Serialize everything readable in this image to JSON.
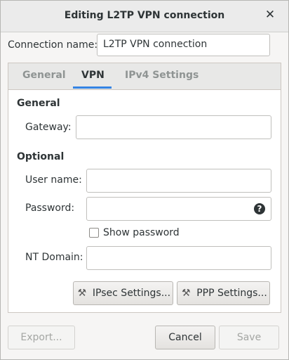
{
  "window": {
    "title": "Editing L2TP VPN connection"
  },
  "connection": {
    "label": "Connection name:",
    "value": "L2TP VPN connection"
  },
  "tabs": [
    {
      "label": "General"
    },
    {
      "label": "VPN"
    },
    {
      "label": "IPv4 Settings"
    }
  ],
  "vpn": {
    "general_heading": "General",
    "gateway_label": "Gateway:",
    "gateway_value": "",
    "optional_heading": "Optional",
    "username_label": "User name:",
    "username_value": "",
    "password_label": "Password:",
    "password_value": "",
    "show_password_label": "Show password",
    "show_password_checked": false,
    "ntdomain_label": "NT Domain:",
    "ntdomain_value": "",
    "ipsec_button": "IPsec Settings...",
    "ppp_button": "PPP Settings..."
  },
  "footer": {
    "export": "Export...",
    "cancel": "Cancel",
    "save": "Save"
  },
  "colors": {
    "accent": "#3584e4"
  }
}
